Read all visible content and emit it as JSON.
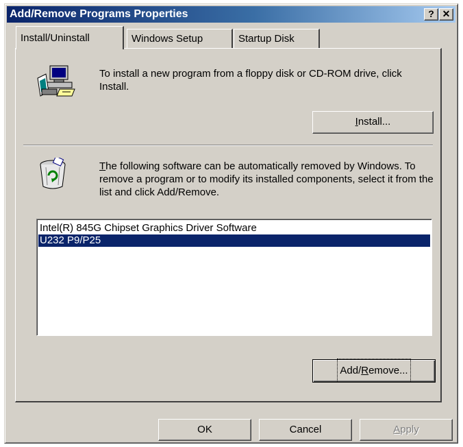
{
  "window": {
    "title": "Add/Remove Programs Properties",
    "help_label": "?",
    "close_label": "✕"
  },
  "tabs": [
    {
      "label": "Install/Uninstall",
      "active": true
    },
    {
      "label": "Windows Setup",
      "active": false
    },
    {
      "label": "Startup Disk",
      "active": false
    }
  ],
  "install": {
    "icon": "floppy-computer-icon",
    "description": "To install a new program from a floppy disk or CD-ROM drive, click Install.",
    "button_mnemonic": "I",
    "button_rest": "nstall..."
  },
  "uninstall": {
    "icon": "recycle-bin-icon",
    "description_mnemonic": "T",
    "description_rest": "he following software can be automatically removed by Windows. To remove a program or to modify its installed components, select it from the list and click Add/Remove.",
    "items": [
      {
        "label": "Intel(R) 845G Chipset Graphics Driver Software",
        "selected": false
      },
      {
        "label": "U232 P9/P25",
        "selected": true
      }
    ],
    "button_prefix": "Add/",
    "button_mnemonic": "R",
    "button_rest": "emove..."
  },
  "footer": {
    "ok_label": "OK",
    "cancel_label": "Cancel",
    "apply_mnemonic": "A",
    "apply_rest": "pply"
  },
  "colors": {
    "titlebar_start": "#0a246a",
    "titlebar_end": "#a6caf0",
    "face": "#d4d0c8",
    "selection": "#0a246a"
  }
}
